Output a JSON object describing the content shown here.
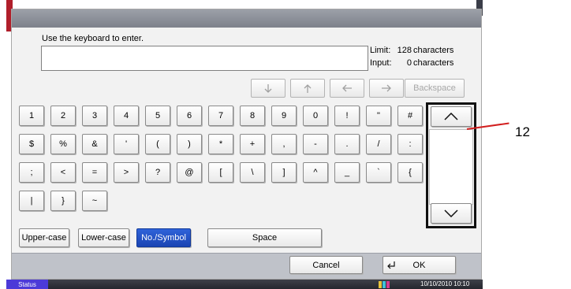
{
  "dialog": {
    "prompt": "Use the keyboard to enter.",
    "input_value": "",
    "limit_label": "Limit:",
    "limit_value": "128",
    "input_label": "Input:",
    "input_count": "0",
    "units": "characters"
  },
  "nav": {
    "down": "arrow-down-icon",
    "up": "arrow-up-icon",
    "left": "arrow-left-icon",
    "right": "arrow-right-icon",
    "backspace": "Backspace"
  },
  "keyboard": {
    "rows": [
      [
        "1",
        "2",
        "3",
        "4",
        "5",
        "6",
        "7",
        "8",
        "9",
        "0",
        "!",
        "\"",
        "#"
      ],
      [
        "$",
        "%",
        "&",
        "'",
        "(",
        ")",
        "*",
        "+",
        ",",
        "-",
        ".",
        "/",
        ":"
      ],
      [
        ";",
        "<",
        "=",
        ">",
        "?",
        "@",
        "[",
        "\\",
        "]",
        "^",
        "_",
        "`",
        "{"
      ],
      [
        "|",
        "}",
        "~"
      ]
    ]
  },
  "modes": {
    "upper": "Upper-case",
    "lower": "Lower-case",
    "symbol": "No./Symbol",
    "space": "Space"
  },
  "footer": {
    "cancel": "Cancel",
    "ok": "OK"
  },
  "callout": "12",
  "statusbar": {
    "status": "Status",
    "datetime": "10/10/2010  10:10"
  }
}
